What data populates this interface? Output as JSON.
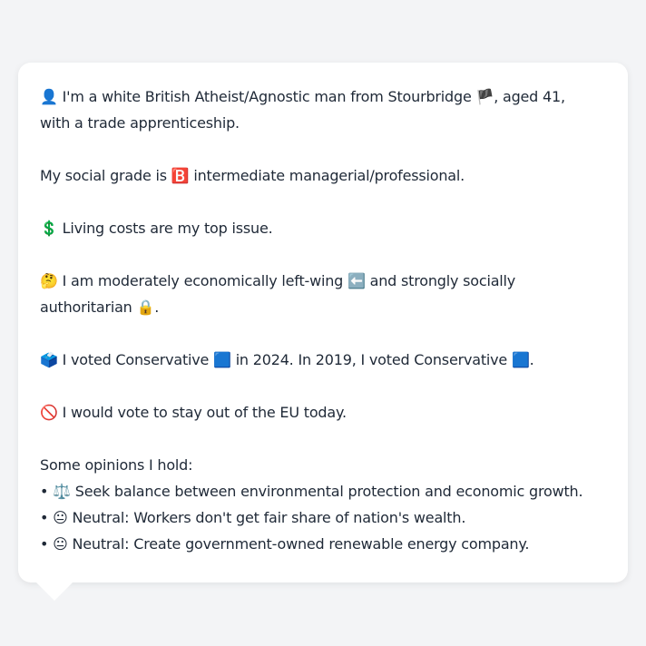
{
  "message": {
    "lines": [
      "👤 I'm a white British Atheist/Agnostic man from Stourbridge 🏴, aged 41,",
      "with a trade apprenticeship.",
      "",
      "My social grade is 🅱️ intermediate managerial/professional.",
      "",
      "💲 Living costs are my top issue.",
      "",
      "🤔 I am moderately economically left-wing ⬅️ and strongly socially",
      "authoritarian 🔒.",
      "",
      "🗳️ I voted Conservative 🟦 in 2024. In 2019, I voted Conservative 🟦.",
      "",
      "🚫 I would vote to stay out of the EU today.",
      "",
      "Some opinions I hold:",
      "• ⚖️ Seek balance between environmental protection and economic growth.",
      "• 😐 Neutral: Workers don't get fair share of nation's wealth.",
      "• 😐 Neutral: Create government-owned renewable energy company."
    ]
  }
}
